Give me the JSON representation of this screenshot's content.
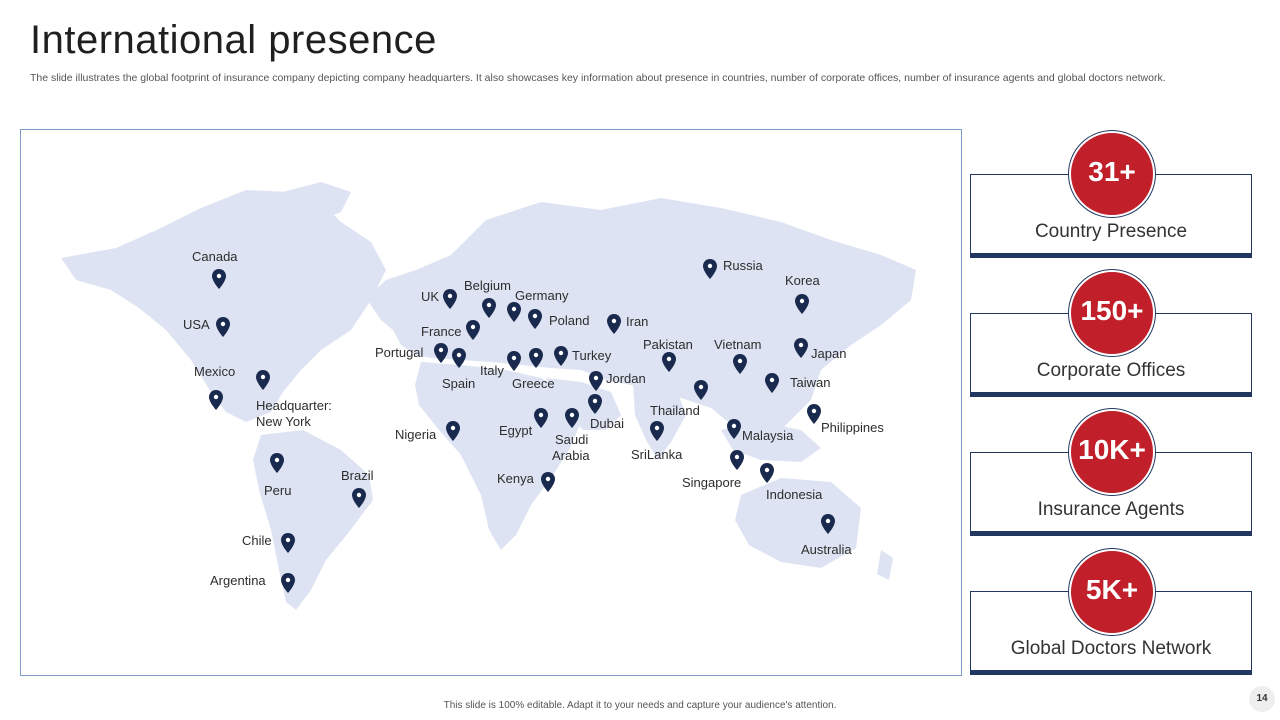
{
  "title": "International presence",
  "subtitle": "The slide illustrates the global footprint of insurance company depicting company headquarters. It also showcases key information about presence in countries, number of corporate offices, number of insurance agents and global doctors network.",
  "map": {
    "locations": [
      "Canada",
      "USA",
      "Mexico",
      "Headquarter:",
      "New York",
      "Peru",
      "Brazil",
      "Chile",
      "Argentina",
      "UK",
      "Belgium",
      "Germany",
      "France",
      "Poland",
      "Iran",
      "Portugal",
      "Spain",
      "Italy",
      "Greece",
      "Turkey",
      "Jordan",
      "Nigeria",
      "Egypt",
      "Saudi",
      "Arabia",
      "Dubai",
      "Kenya",
      "Russia",
      "Korea",
      "Pakistan",
      "Vietnam",
      "Japan",
      "Taiwan",
      "Thailand",
      "Malaysia",
      "Philippines",
      "SriLanka",
      "Singapore",
      "Indonesia",
      "Australia"
    ]
  },
  "stats": [
    {
      "value": "31+",
      "label": "Country Presence"
    },
    {
      "value": "150+",
      "label": "Corporate Offices"
    },
    {
      "value": "10K+",
      "label": "Insurance Agents"
    },
    {
      "value": "5K+",
      "label": "Global Doctors Network"
    }
  ],
  "footer": "This slide is 100% editable.  Adapt it to your needs and capture your audience's attention.",
  "page_number": "14",
  "colors": {
    "accent": "#c11f2a",
    "navy": "#22375f",
    "land": "#dde3f2"
  }
}
